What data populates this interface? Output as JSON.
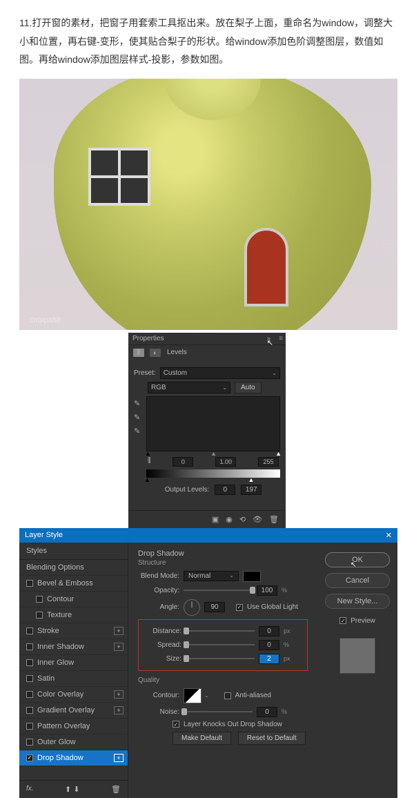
{
  "instruction": "11.打开窗的素材，把窗子用套索工具抠出来。放在梨子上面，重命名为window，调整大小和位置，再右键-变形，使其贴合梨子的形状。给window添加色阶调整图层，数值如图。再给window添加图层样式-投影，参数如图。",
  "watermark": "⊙ralpa88",
  "properties": {
    "title": "Properties",
    "adjustment": "Levels",
    "preset_label": "Preset:",
    "preset_value": "Custom",
    "channel": "RGB",
    "auto": "Auto",
    "in_black": "0",
    "in_mid": "1.00",
    "in_white": "255",
    "output_label": "Output Levels:",
    "out_black": "0",
    "out_white": "197"
  },
  "layerstyle": {
    "title": "Layer Style",
    "styles_head": "Styles",
    "left": {
      "blending": "Blending Options",
      "bevel": "Bevel & Emboss",
      "contour": "Contour",
      "texture": "Texture",
      "stroke": "Stroke",
      "inner_shadow": "Inner Shadow",
      "inner_glow": "Inner Glow",
      "satin": "Satin",
      "color_overlay": "Color Overlay",
      "gradient_overlay": "Gradient Overlay",
      "pattern_overlay": "Pattern Overlay",
      "outer_glow": "Outer Glow",
      "drop_shadow": "Drop Shadow"
    },
    "center": {
      "heading": "Drop Shadow",
      "structure": "Structure",
      "blend_mode_label": "Blend Mode:",
      "blend_mode": "Normal",
      "opacity_label": "Opacity:",
      "opacity_val": "100",
      "opacity_unit": "%",
      "angle_label": "Angle:",
      "angle_val": "90",
      "global_light": "Use Global Light",
      "distance_label": "Distance:",
      "distance_val": "0",
      "distance_unit": "px",
      "spread_label": "Spread:",
      "spread_val": "0",
      "spread_unit": "%",
      "size_label": "Size:",
      "size_val": "2",
      "size_unit": "px",
      "quality": "Quality",
      "contour_label": "Contour:",
      "antialiased": "Anti-aliased",
      "noise_label": "Noise:",
      "noise_val": "0",
      "noise_unit": "%",
      "knockout": "Layer Knocks Out Drop Shadow",
      "make_default": "Make Default",
      "reset_default": "Reset to Default"
    },
    "right": {
      "ok": "OK",
      "cancel": "Cancel",
      "new_style": "New Style...",
      "preview": "Preview"
    },
    "fx": "fx."
  }
}
